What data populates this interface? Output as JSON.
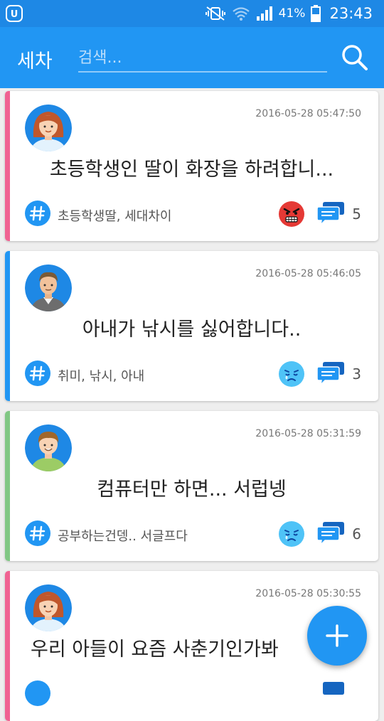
{
  "status_bar": {
    "battery_text": "41%",
    "time": "23:43"
  },
  "app_bar": {
    "title": "세차",
    "search_placeholder": "검색..."
  },
  "posts": [
    {
      "timestamp": "2016-05-28 05:47:50",
      "title": "초등학생인 딸이 화장을 하려합니...",
      "tags": "초등학생딸, 세대차이",
      "comment_count": "5",
      "accent_color": "#f06292",
      "mood": "angry-face-icon",
      "avatar": "woman-avatar-icon"
    },
    {
      "timestamp": "2016-05-28 05:46:05",
      "title": "아내가 낚시를 싫어합니다..",
      "tags": "취미, 낚시, 아내",
      "comment_count": "3",
      "accent_color": "#2196f3",
      "mood": "sad-face-icon",
      "avatar": "man-avatar-icon"
    },
    {
      "timestamp": "2016-05-28 05:31:59",
      "title": "컴퓨터만 하면... 서럽넹",
      "tags": "공부하는건뎅.. 서글프다",
      "comment_count": "6",
      "accent_color": "#81c784",
      "mood": "sad-face-icon",
      "avatar": "boy-avatar-icon"
    },
    {
      "timestamp": "2016-05-28 05:30:55",
      "title": "우리 아들이 요즘 사춘기인가봐",
      "tags": "",
      "comment_count": "",
      "accent_color": "#f06292",
      "mood": "",
      "avatar": "woman-avatar-icon"
    }
  ],
  "fab": {
    "icon": "plus-icon"
  },
  "colors": {
    "primary": "#2196f3",
    "status_bar": "#1e88e5"
  }
}
